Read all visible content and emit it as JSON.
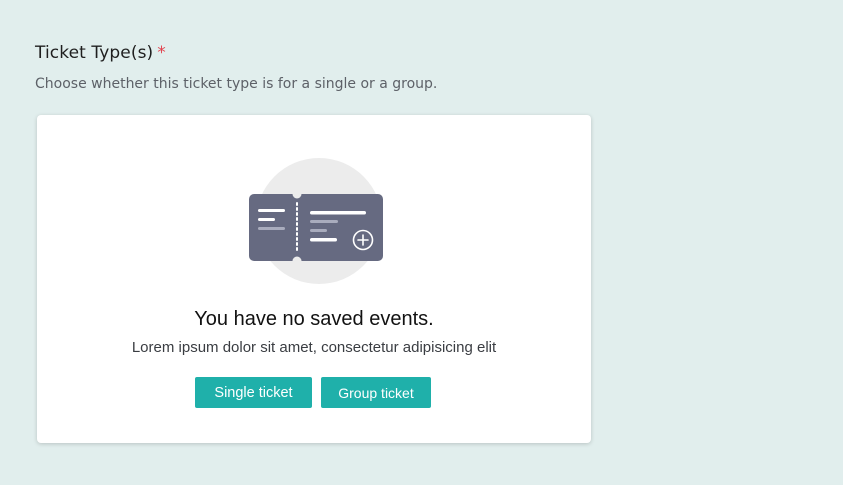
{
  "field": {
    "title": "Ticket Type(s)",
    "required_mark": "*",
    "subtitle": "Choose whether this ticket type is for a single or a group."
  },
  "empty_state": {
    "illustration_icon": "ticket-add-icon",
    "title": "You have no saved events.",
    "description": "Lorem ipsum dolor sit amet, consectetur adipisicing elit",
    "buttons": {
      "single": "Single ticket",
      "group": "Group ticket"
    }
  },
  "colors": {
    "background": "#e1eeed",
    "accent": "#1fb0aa",
    "required": "#e2434f",
    "ticket": "#666a81",
    "circle": "#ececec"
  }
}
